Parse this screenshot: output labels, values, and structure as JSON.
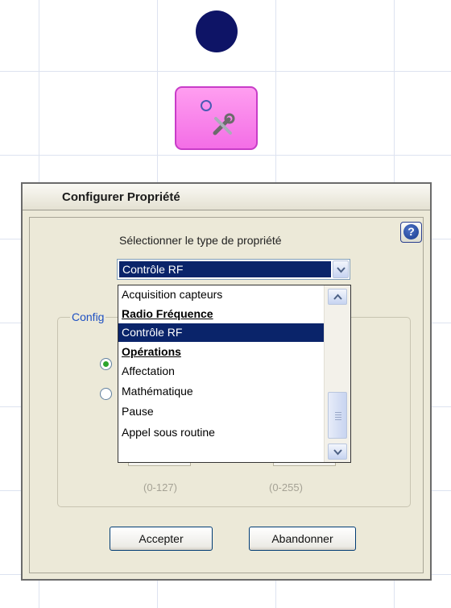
{
  "canvas": {
    "dot_color": "#0e1466",
    "tool_block_color": "#f36ee6",
    "tool_block_icons": [
      "circle-icon",
      "tools-icon"
    ]
  },
  "dialog": {
    "title": "Configurer Propriété",
    "help_icon": "help-icon",
    "help_glyph": "?",
    "prompt_label": "Sélectionner le type de propriété",
    "selected_value": "Contrôle RF",
    "group_label_partial": "Config",
    "ranges": [
      "(0-127)",
      "(0-255)"
    ],
    "buttons": {
      "accept": "Accepter",
      "cancel": "Abandonner"
    }
  },
  "dropdown": {
    "items": [
      {
        "label": "Acquisition capteurs",
        "type": "item"
      },
      {
        "label": "Radio Fréquence",
        "type": "group"
      },
      {
        "label": "Contrôle RF",
        "type": "selected"
      },
      {
        "label": "Opérations",
        "type": "group"
      },
      {
        "label": "Affectation",
        "type": "item"
      },
      {
        "label": "Mathématique",
        "type": "item"
      },
      {
        "label": "Pause",
        "type": "item"
      },
      {
        "label": "Appel sous routine",
        "type": "item"
      }
    ]
  },
  "colors": {
    "selection": "#0a246a",
    "dialog_bg": "#ece9d8",
    "group_label": "#1e50c2"
  }
}
